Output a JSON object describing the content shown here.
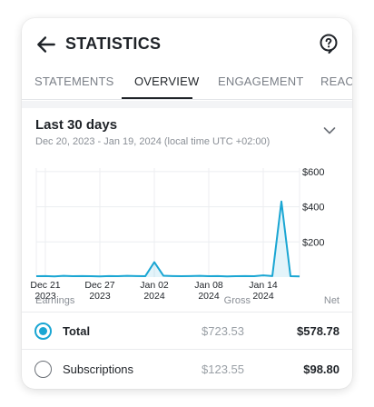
{
  "header": {
    "title": "STATISTICS",
    "back_icon": "arrow-left-icon",
    "help_icon": "help-circle-icon"
  },
  "tabs": [
    {
      "label": "STATEMENTS",
      "active": false
    },
    {
      "label": "OVERVIEW",
      "active": true
    },
    {
      "label": "ENGAGEMENT",
      "active": false
    },
    {
      "label": "REACH",
      "active": false
    }
  ],
  "period": {
    "title": "Last 30 days",
    "range": "Dec 20, 2023 - Jan 19, 2024 (local time UTC +02:00)",
    "chevron_icon": "chevron-down-icon"
  },
  "chart_data": {
    "type": "area",
    "color": "#1aa6d3",
    "x_ticks": [
      {
        "line1": "Dec 21",
        "line2": "2023",
        "index": 1
      },
      {
        "line1": "Dec 27",
        "line2": "2023",
        "index": 7
      },
      {
        "line1": "Jan 02",
        "line2": "2024",
        "index": 13
      },
      {
        "line1": "Jan 08",
        "line2": "2024",
        "index": 19
      },
      {
        "line1": "Jan 14",
        "line2": "2024",
        "index": 25
      }
    ],
    "y_ticks": [
      {
        "label": "$600",
        "value": 600
      },
      {
        "label": "$400",
        "value": 400
      },
      {
        "label": "$200",
        "value": 200
      }
    ],
    "ylim": [
      0,
      620
    ],
    "values": [
      5,
      6,
      4,
      7,
      5,
      6,
      5,
      4,
      6,
      5,
      7,
      6,
      5,
      85,
      8,
      6,
      5,
      6,
      7,
      5,
      6,
      4,
      5,
      6,
      5,
      10,
      6,
      430,
      5,
      4
    ]
  },
  "table": {
    "headers": {
      "earnings": "Earnings",
      "gross": "Gross",
      "net": "Net"
    },
    "rows": [
      {
        "label": "Total",
        "gross": "$723.53",
        "net": "$578.78",
        "selected": true
      },
      {
        "label": "Subscriptions",
        "gross": "$123.55",
        "net": "$98.80",
        "selected": false
      }
    ]
  }
}
